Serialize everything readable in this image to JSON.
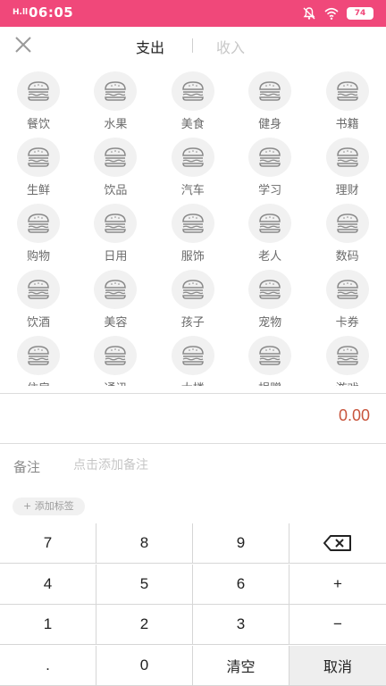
{
  "status_bar": {
    "signal": "H.ll",
    "time": "06:05",
    "battery": "74"
  },
  "header": {
    "close_icon": "close-icon",
    "tab_expense": "支出",
    "tab_income": "收入"
  },
  "categories": [
    "餐饮",
    "水果",
    "美食",
    "健身",
    "书籍",
    "生鲜",
    "饮品",
    "汽车",
    "学习",
    "理财",
    "购物",
    "日用",
    "服饰",
    "老人",
    "数码",
    "饮酒",
    "美容",
    "孩子",
    "宠物",
    "卡券",
    "住房",
    "通讯",
    "大楼",
    "捐赠",
    "游戏"
  ],
  "amount": "0.00",
  "note": {
    "label": "备注",
    "placeholder": "点击添加备注"
  },
  "tag_button": "+ 添加标签",
  "keypad": [
    [
      "7",
      "8",
      "9",
      "⌫"
    ],
    [
      "4",
      "5",
      "6",
      "+"
    ],
    [
      "1",
      "2",
      "3",
      "−"
    ],
    [
      ".",
      "0",
      "清空",
      "取消"
    ]
  ],
  "colors": {
    "accent": "#f0487a",
    "amount": "#c8553d"
  }
}
